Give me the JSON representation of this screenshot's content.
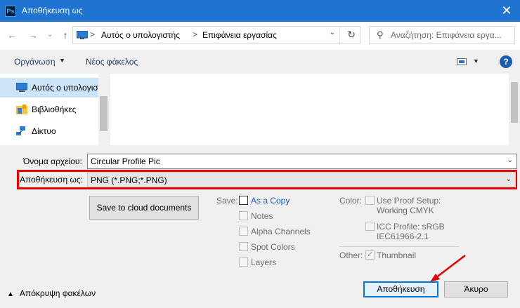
{
  "titlebar": {
    "app_icon": "Ps",
    "title": "Αποθήκευση ως",
    "close": "✕"
  },
  "nav": {
    "back": "←",
    "forward": "→",
    "recent": "⌄",
    "up": "↑",
    "breadcrumb": [
      "Αυτός ο υπολογιστής",
      "Επιφάνεια εργασίας"
    ],
    "sep": ">",
    "search_placeholder": "Αναζήτηση: Επιφάνεια εργα..."
  },
  "toolbar": {
    "organize": "Οργάνωση",
    "new_folder": "Νέος φάκελος",
    "help": "?"
  },
  "tree": [
    {
      "label": "Αυτός ο υπολογιστής",
      "icon": "computer-icon",
      "selected": true
    },
    {
      "label": "Βιβλιοθήκες",
      "icon": "library-icon",
      "selected": false
    },
    {
      "label": "Δίκτυο",
      "icon": "network-icon",
      "selected": false
    }
  ],
  "form": {
    "filename_label": "Όνομα αρχείου:",
    "filename_value": "Circular Profile Pic",
    "saveas_label": "Αποθήκευση ως:",
    "saveas_value": "PNG (*.PNG;*.PNG)",
    "cloud_button": "Save to cloud documents"
  },
  "save_options": {
    "caption": "Save:",
    "items": [
      "As a Copy",
      "Notes",
      "Alpha Channels",
      "Spot Colors",
      "Layers"
    ]
  },
  "color_options": {
    "caption": "Color:",
    "proof_line1": "Use Proof Setup:",
    "proof_line2": "Working CMYK",
    "icc_line1": "ICC Profile:  sRGB",
    "icc_line2": "IEC61966-2.1"
  },
  "other_options": {
    "caption": "Other:",
    "thumbnail": "Thumbnail"
  },
  "footer": {
    "hide_folders": "Απόκρυψη φακέλων",
    "save": "Αποθήκευση",
    "cancel": "Άκυρο"
  },
  "colors": {
    "titlebar": "#1e74d0",
    "highlight": "#e60000",
    "selection": "#cce4f7",
    "primary_border": "#0078d7"
  }
}
